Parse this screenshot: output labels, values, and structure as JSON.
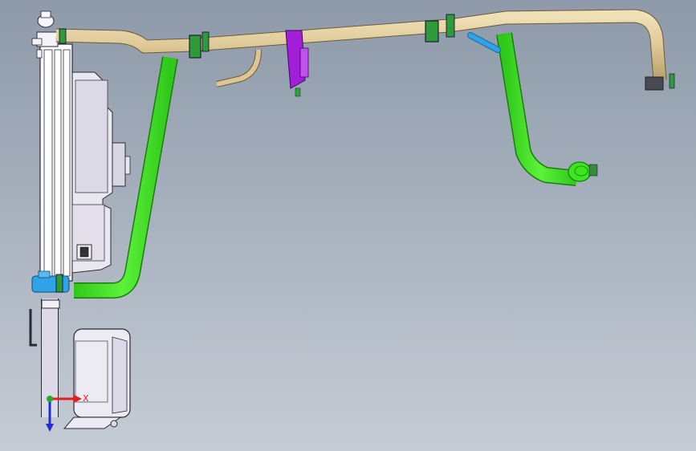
{
  "viewport": {
    "background_top": "#8e9aa9",
    "background_bottom": "#c6ccd5"
  },
  "triad": {
    "x_label": "X",
    "x_color": "#e02020",
    "y_color": "#20b020",
    "z_color": "#2030d0"
  },
  "parts": {
    "radiator_color": "#ffffff",
    "radiator_outline": "#2a2a35",
    "fan_shroud_color": "#e9e7f0",
    "tan_pipe_color": "#ddc694",
    "green_hose_color": "#39e61f",
    "blue_part_color": "#2fa3e6",
    "purple_bracket_color": "#a21ed8",
    "surge_tank_color": "#eceaf2"
  }
}
